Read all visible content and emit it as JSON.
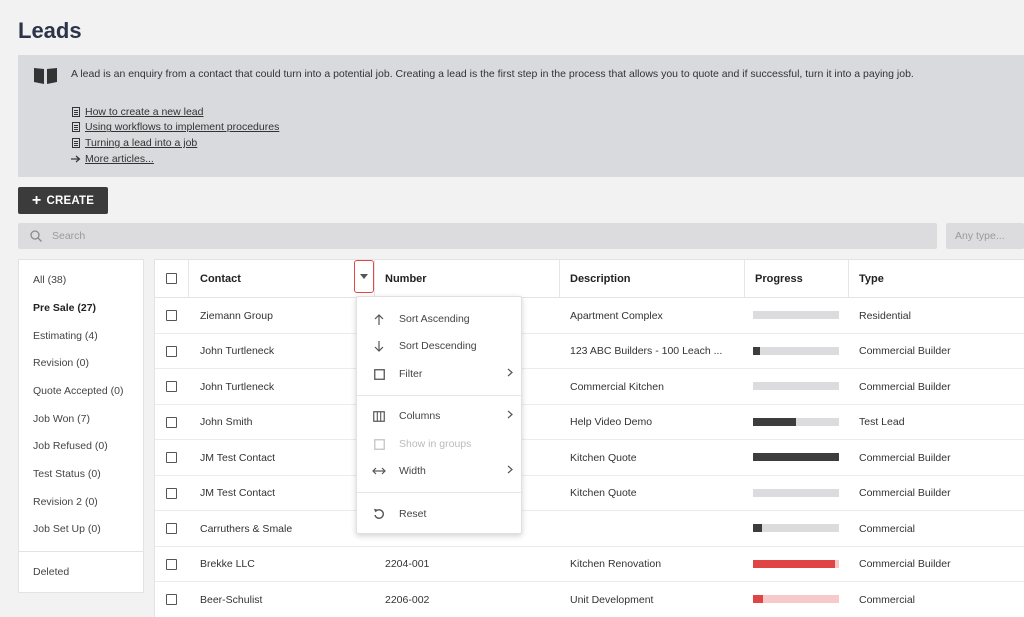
{
  "page": {
    "title": "Leads"
  },
  "info": {
    "description": "A lead is an enquiry from a contact that could turn into a potential job. Creating a lead is the first step in the process that allows you to quote and if successful, turn it into a paying job.",
    "links": [
      {
        "icon": "document-icon",
        "label": "How to create a new lead"
      },
      {
        "icon": "document-icon",
        "label": "Using workflows to implement procedures"
      },
      {
        "icon": "document-icon",
        "label": "Turning a lead into a job"
      },
      {
        "icon": "arrow-right-icon",
        "label": "More articles..."
      }
    ]
  },
  "toolbar": {
    "create_label": "CREATE"
  },
  "search": {
    "placeholder": "Search",
    "type_placeholder": "Any type..."
  },
  "sidebar": {
    "items": [
      {
        "label": "All (38)",
        "active": false
      },
      {
        "label": "Pre Sale (27)",
        "active": true
      },
      {
        "label": "Estimating (4)",
        "active": false
      },
      {
        "label": "Revision (0)",
        "active": false
      },
      {
        "label": "Quote Accepted (0)",
        "active": false
      },
      {
        "label": "Job Won (7)",
        "active": false
      },
      {
        "label": "Job Refused (0)",
        "active": false
      },
      {
        "label": "Test Status (0)",
        "active": false
      },
      {
        "label": "Revision 2 (0)",
        "active": false
      },
      {
        "label": "Job Set Up (0)",
        "active": false
      }
    ],
    "deleted_label": "Deleted"
  },
  "table": {
    "columns": [
      "Contact",
      "Number",
      "Description",
      "Progress",
      "Type"
    ],
    "rows": [
      {
        "contact": "Ziemann Group",
        "number": "",
        "description": "Apartment Complex",
        "progress": 0,
        "progress_color": "#3d3d3d",
        "type": "Residential"
      },
      {
        "contact": "John Turtleneck",
        "number": "",
        "description": "123 ABC Builders - 100 Leach ...",
        "progress": 0.08,
        "progress_color": "#3d3d3d",
        "type": "Commercial Builder"
      },
      {
        "contact": "John Turtleneck",
        "number": "",
        "description": "Commercial Kitchen",
        "progress": 0,
        "progress_color": "#3d3d3d",
        "type": "Commercial Builder"
      },
      {
        "contact": "John Smith",
        "number": "",
        "description": "Help Video Demo",
        "progress": 0.5,
        "progress_color": "#3d3d3d",
        "type": "Test Lead"
      },
      {
        "contact": "JM Test Contact",
        "number": "",
        "description": "Kitchen Quote",
        "progress": 1,
        "progress_color": "#3d3d3d",
        "type": "Commercial Builder"
      },
      {
        "contact": "JM Test Contact",
        "number": "",
        "description": "Kitchen Quote",
        "progress": 0,
        "progress_color": "#3d3d3d",
        "type": "Commercial Builder"
      },
      {
        "contact": "Carruthers & Smale",
        "number": "",
        "description": "",
        "progress": 0.1,
        "progress_color": "#3d3d3d",
        "type": "Commercial"
      },
      {
        "contact": "Brekke LLC",
        "number": "2204-001",
        "description": "Kitchen Renovation",
        "progress": 0.95,
        "progress_color": "#e04545",
        "type": "Commercial Builder"
      },
      {
        "contact": "Beer-Schulist",
        "number": "2206-002",
        "description": "Unit Development",
        "progress": 0.12,
        "progress_color": "#e04545",
        "type": "Commercial"
      }
    ]
  },
  "column_menu": {
    "items": [
      {
        "icon": "arrow-up-icon",
        "label": "Sort Ascending",
        "submenu": false,
        "disabled": false
      },
      {
        "icon": "arrow-down-icon",
        "label": "Sort Descending",
        "submenu": false,
        "disabled": false
      },
      {
        "icon": "filter-icon",
        "label": "Filter",
        "submenu": true,
        "disabled": false
      },
      {
        "icon": "columns-icon",
        "label": "Columns",
        "submenu": true,
        "disabled": false
      },
      {
        "icon": "checkbox-icon",
        "label": "Show in groups",
        "submenu": false,
        "disabled": true
      },
      {
        "icon": "width-icon",
        "label": "Width",
        "submenu": true,
        "disabled": false
      },
      {
        "icon": "reset-icon",
        "label": "Reset",
        "submenu": false,
        "disabled": false
      }
    ]
  }
}
